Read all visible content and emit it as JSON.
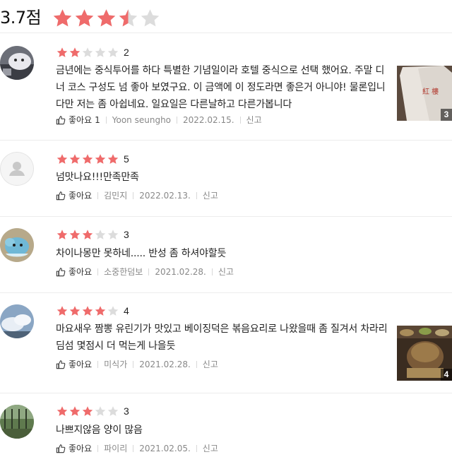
{
  "summary": {
    "score_text": "3.7점",
    "rating": 3.5,
    "star_color": "#ef6b6b",
    "empty_star_color": "#dcdcdc"
  },
  "reviews": [
    {
      "rating": 2,
      "rating_text": "2",
      "text": "금년에는 중식투어를 하다 특별한 기념일이라 호텔 중식으로 선택 했어요. 주말 디너 코스 구성도 넘 좋아 보였구요. 이 금액에 이 정도라면 좋은거 아니야! 물론입니다만 저는 좀 아쉽네요. 일요일은 다른날하고 다른가봅니다",
      "like_label": "좋아요",
      "like_count": "1",
      "author": "Yoon seungho",
      "date": "2022.02.15.",
      "report_label": "신고",
      "photo_count": "3",
      "avatar": "avatar-photo"
    },
    {
      "rating": 5,
      "rating_text": "5",
      "text": "넘맛나요!!!만족만족",
      "like_label": "좋아요",
      "like_count": "",
      "author": "김민지",
      "date": "2022.02.13.",
      "report_label": "신고",
      "photo_count": "",
      "avatar": "default-avatar"
    },
    {
      "rating": 3,
      "rating_text": "3",
      "text": "차이나몽만 못하네..... 반성 좀 하셔야할듯",
      "like_label": "좋아요",
      "like_count": "",
      "author": "소중한덤보",
      "date": "2021.02.28.",
      "report_label": "신고",
      "photo_count": "",
      "avatar": "avatar-photo"
    },
    {
      "rating": 4,
      "rating_text": "4",
      "text": "마요새우 짬뽕 유린기가 맛있고 베이징덕은 볶음요리로 나왔을때 좀 질겨서 차라리 딤섬 몇점시 더 먹는게 나을듯",
      "like_label": "좋아요",
      "like_count": "",
      "author": "미식가",
      "date": "2021.02.28.",
      "report_label": "신고",
      "photo_count": "4",
      "avatar": "avatar-photo"
    },
    {
      "rating": 3,
      "rating_text": "3",
      "text": "나쁘지않음 양이 많음",
      "like_label": "좋아요",
      "like_count": "",
      "author": "파이리",
      "date": "2021.02.05.",
      "report_label": "신고",
      "photo_count": "",
      "avatar": "avatar-photo"
    }
  ]
}
